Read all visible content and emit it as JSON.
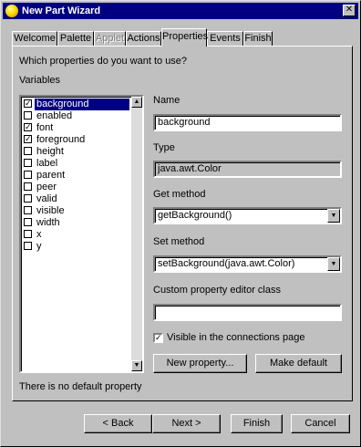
{
  "window": {
    "title": "New Part Wizard",
    "close_glyph": "✕"
  },
  "tabs": [
    {
      "label": "Welcome",
      "state": "normal"
    },
    {
      "label": "Palette",
      "state": "normal"
    },
    {
      "label": "Applet",
      "state": "disabled"
    },
    {
      "label": "Actions",
      "state": "normal"
    },
    {
      "label": "Properties",
      "state": "active"
    },
    {
      "label": "Events",
      "state": "normal"
    },
    {
      "label": "Finish",
      "state": "normal"
    }
  ],
  "panel": {
    "question": "Which properties do you want to use?",
    "variables_label": "Variables",
    "variables": [
      {
        "name": "background",
        "checked": true,
        "selected": true
      },
      {
        "name": "enabled",
        "checked": false
      },
      {
        "name": "font",
        "checked": true
      },
      {
        "name": "foreground",
        "checked": true
      },
      {
        "name": "height",
        "checked": false
      },
      {
        "name": "label",
        "checked": false
      },
      {
        "name": "parent",
        "checked": false
      },
      {
        "name": "peer",
        "checked": false
      },
      {
        "name": "valid",
        "checked": false
      },
      {
        "name": "visible",
        "checked": false
      },
      {
        "name": "width",
        "checked": false
      },
      {
        "name": "x",
        "checked": false
      },
      {
        "name": "y",
        "checked": false
      }
    ],
    "checkmark": "✓",
    "scroll_up_glyph": "▲",
    "scroll_down_glyph": "▼",
    "name_label": "Name",
    "name_value": "background",
    "type_label": "Type",
    "type_value": "java.awt.Color",
    "get_method_label": "Get method",
    "get_method_value": "getBackground()",
    "set_method_label": "Set method",
    "set_method_value": "setBackground(java.awt.Color)",
    "dropdown_glyph": "▼",
    "editor_class_label": "Custom property editor class",
    "editor_class_value": "",
    "visible_connections_label": "Visible in the connections page",
    "visible_connections_checked": true,
    "new_property_button": "New property...",
    "make_default_button": "Make default",
    "default_status": "There is no default property"
  },
  "footer": {
    "back_button": "< Back",
    "next_button": "Next >",
    "finish_button": "Finish",
    "cancel_button": "Cancel"
  }
}
